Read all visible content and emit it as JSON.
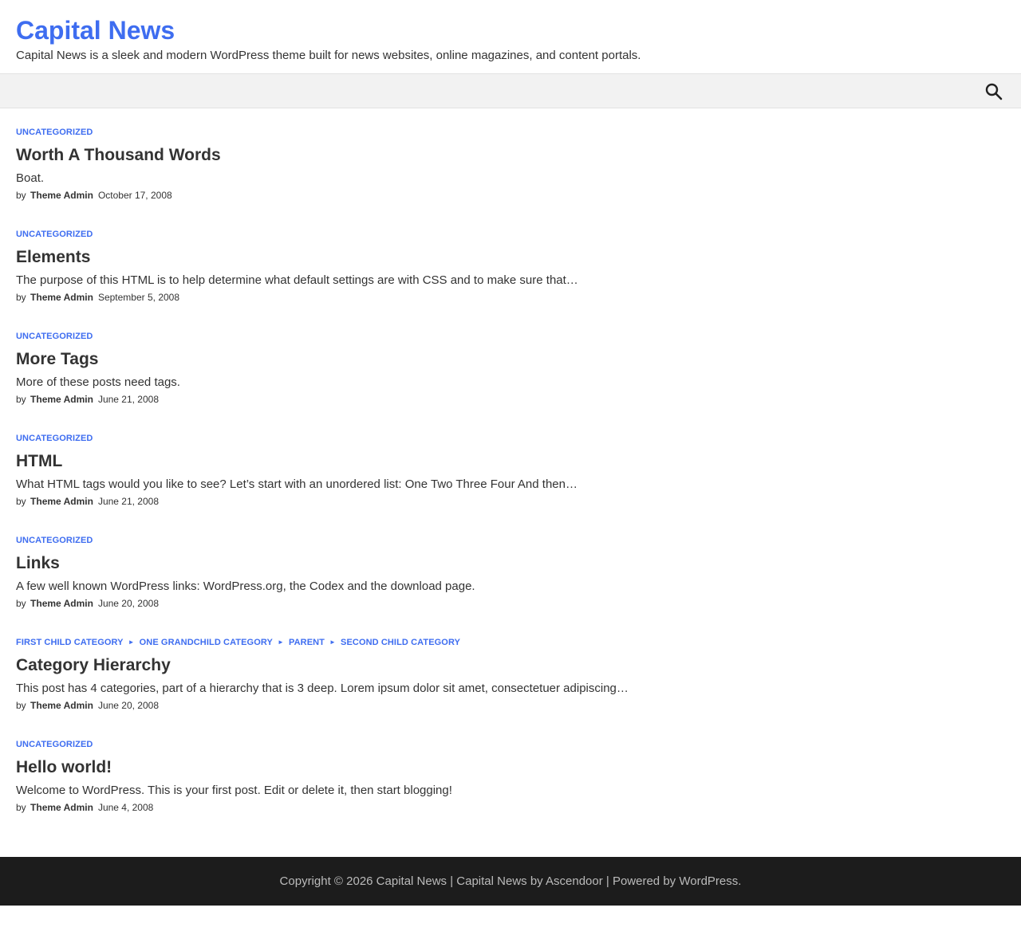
{
  "site": {
    "title": "Capital News",
    "description": "Capital News is a sleek and modern WordPress theme built for news websites, online magazines, and content portals."
  },
  "nav": {
    "search_icon": "search-icon"
  },
  "posts": [
    {
      "categories": [
        "Uncategorized"
      ],
      "title": "Worth A Thousand Words",
      "excerpt": "Boat.",
      "by": "by",
      "author": "Theme Admin",
      "date": "October 17, 2008"
    },
    {
      "categories": [
        "Uncategorized"
      ],
      "title": "Elements",
      "excerpt": "The purpose of this HTML is to help determine what default settings are with CSS and to make sure that…",
      "by": "by",
      "author": "Theme Admin",
      "date": "September 5, 2008"
    },
    {
      "categories": [
        "Uncategorized"
      ],
      "title": "More Tags",
      "excerpt": "More of these posts need tags.",
      "by": "by",
      "author": "Theme Admin",
      "date": "June 21, 2008"
    },
    {
      "categories": [
        "Uncategorized"
      ],
      "title": "HTML",
      "excerpt": "What HTML tags would you like to see? Let’s start with an unordered list: One Two Three Four And then…",
      "by": "by",
      "author": "Theme Admin",
      "date": "June 21, 2008"
    },
    {
      "categories": [
        "Uncategorized"
      ],
      "title": "Links",
      "excerpt": "A few well known WordPress links: WordPress.org, the Codex and the download page.",
      "by": "by",
      "author": "Theme Admin",
      "date": "June 20, 2008"
    },
    {
      "categories": [
        "First Child Category",
        "One Grandchild Category",
        "Parent",
        "Second Child Category"
      ],
      "title": "Category Hierarchy",
      "excerpt": "This post has 4 categories, part of a hierarchy that is 3 deep. Lorem ipsum dolor sit amet, consectetuer adipiscing…",
      "by": "by",
      "author": "Theme Admin",
      "date": "June 20, 2008"
    },
    {
      "categories": [
        "Uncategorized"
      ],
      "title": "Hello world!",
      "excerpt": "Welcome to WordPress. This is your first post. Edit or delete it, then start blogging!",
      "by": "by",
      "author": "Theme Admin",
      "date": "June 4, 2008"
    }
  ],
  "footer": {
    "copyright": "Copyright © 2026 ",
    "site_link": "Capital News",
    "sep1": " | Capital News by ",
    "theme_author": "Ascendoor",
    "sep2": " | Powered by ",
    "wp_link": "WordPress",
    "end": "."
  },
  "colors": {
    "accent": "#3e6df0",
    "footer_bg": "#1c1c1c",
    "nav_bg": "#f2f2f2"
  }
}
